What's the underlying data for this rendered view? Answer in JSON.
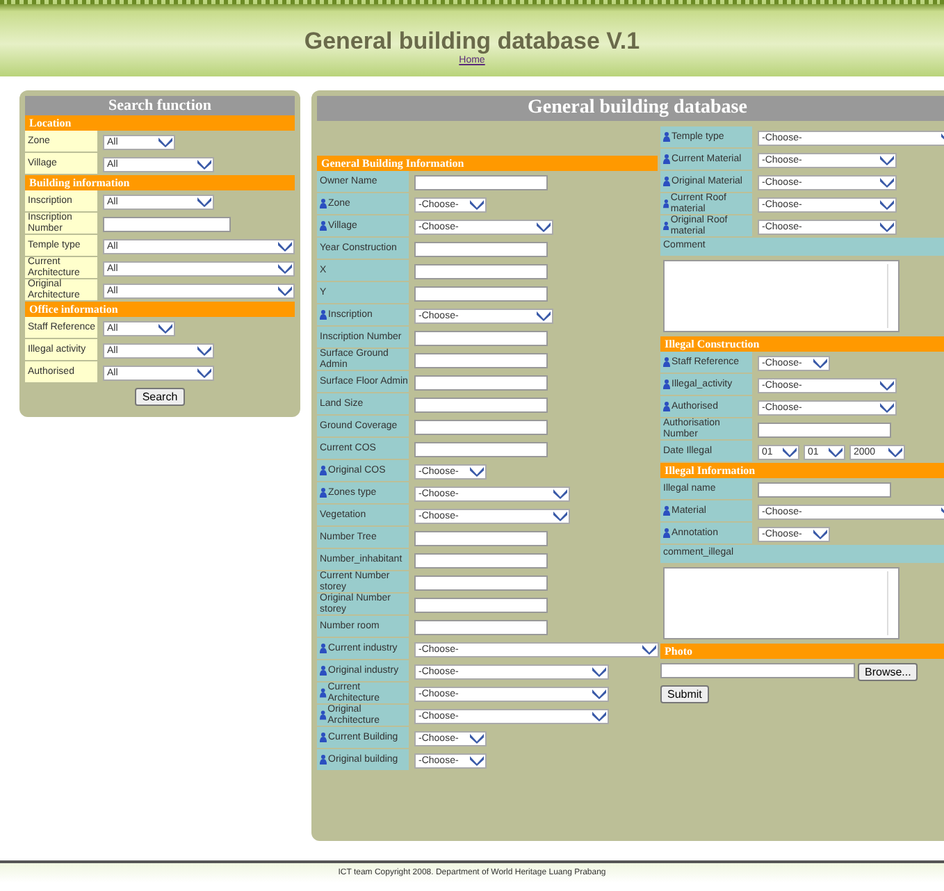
{
  "header": {
    "title": "General building database V.1",
    "link": "Home"
  },
  "search_panel": {
    "title": "Search function",
    "button": "Search",
    "sections": [
      {
        "title": "Location",
        "rows": [
          {
            "label": "Zone",
            "kind": "short-select",
            "value": "All"
          },
          {
            "label": "Village",
            "kind": "select",
            "value": "All"
          }
        ]
      },
      {
        "title": "Building information",
        "rows": [
          {
            "label": "Inscription",
            "kind": "select",
            "value": "All"
          },
          {
            "label": "Inscription Number",
            "kind": "input"
          },
          {
            "label": "Temple type",
            "kind": "wide-select",
            "value": "All"
          },
          {
            "label": "Current Architecture",
            "kind": "wide-select",
            "value": "All"
          },
          {
            "label": "Original Architecture",
            "kind": "wide-select",
            "value": "All"
          }
        ]
      },
      {
        "title": "Office information",
        "rows": [
          {
            "label": "Staff Reference",
            "kind": "short-select",
            "value": "All"
          },
          {
            "label": "Illegal activity",
            "kind": "select",
            "value": "All"
          },
          {
            "label": "Authorised",
            "kind": "select",
            "value": "All"
          }
        ]
      }
    ]
  },
  "main_panel": {
    "title": "General building database",
    "left_sections": [
      {
        "title": "General Building Information",
        "rows": [
          {
            "label": "Owner Name",
            "kind": "input",
            "marked": false
          },
          {
            "label": "Zone",
            "kind": "short-select",
            "value": "-Choose-",
            "marked": true
          },
          {
            "label": "Village",
            "kind": "select",
            "value": "-Choose-",
            "marked": true
          },
          {
            "label": "Year Construction",
            "kind": "input",
            "marked": false
          },
          {
            "label": "X",
            "kind": "input",
            "marked": false
          },
          {
            "label": "Y",
            "kind": "input",
            "marked": false
          },
          {
            "label": "Inscription",
            "kind": "select",
            "value": "-Choose-",
            "marked": true
          },
          {
            "label": "Inscription Number",
            "kind": "input",
            "marked": false
          },
          {
            "label": "Surface Ground Admin",
            "kind": "input",
            "marked": false
          },
          {
            "label": "Surface Floor Admin",
            "kind": "input",
            "marked": false
          },
          {
            "label": "Land Size",
            "kind": "input",
            "marked": false
          },
          {
            "label": "Ground Coverage",
            "kind": "input",
            "marked": false
          },
          {
            "label": "Current COS",
            "kind": "input",
            "marked": false
          },
          {
            "label": "Original COS",
            "kind": "short-select",
            "value": "-Choose-",
            "marked": true
          },
          {
            "label": "Zones type",
            "kind": "medium-select",
            "value": "-Choose-",
            "marked": true
          },
          {
            "label": "Vegetation",
            "kind": "medium-select",
            "value": "-Choose-",
            "marked": false
          },
          {
            "label": "Number Tree",
            "kind": "input",
            "marked": false
          },
          {
            "label": "Number_inhabitant",
            "kind": "input",
            "marked": false
          },
          {
            "label": "Current Number storey",
            "kind": "input",
            "marked": false
          },
          {
            "label": "Original Number storey",
            "kind": "input",
            "marked": false
          },
          {
            "label": "Number room",
            "kind": "input",
            "marked": false
          },
          {
            "label": "Current industry",
            "kind": "wide-select",
            "value": "-Choose-",
            "marked": true
          },
          {
            "label": "Original industry",
            "kind": "large-select",
            "value": "-Choose-",
            "marked": true
          },
          {
            "label": "Current Architecture",
            "kind": "large-select",
            "value": "-Choose-",
            "marked": true
          },
          {
            "label": "Original Architecture",
            "kind": "large-select",
            "value": "-Choose-",
            "marked": true
          },
          {
            "label": "Current Building",
            "kind": "short-select",
            "value": "-Choose-",
            "marked": true
          },
          {
            "label": "Original building",
            "kind": "short-select",
            "value": "-Choose-",
            "marked": true
          }
        ]
      }
    ],
    "right_sections": [
      {
        "rows": [
          {
            "label": "Temple type",
            "kind": "wide-select",
            "value": "-Choose-",
            "marked": true
          },
          {
            "label": "Current Material",
            "kind": "select",
            "value": "-Choose-",
            "marked": true
          },
          {
            "label": "Original Material",
            "kind": "select",
            "value": "-Choose-",
            "marked": true
          },
          {
            "label": "Current Roof material",
            "kind": "select",
            "value": "-Choose-",
            "marked": true
          },
          {
            "label": "Original Roof material",
            "kind": "select",
            "value": "-Choose-",
            "marked": true
          },
          {
            "label": "Comment",
            "kind": "textarea"
          }
        ]
      },
      {
        "title": "Illegal Construction",
        "rows": [
          {
            "label": "Staff Reference",
            "kind": "short-select",
            "value": "-Choose-",
            "marked": true
          },
          {
            "label": "Illegal_activity",
            "kind": "select",
            "value": "-Choose-",
            "marked": true
          },
          {
            "label": "Authorised",
            "kind": "select",
            "value": "-Choose-",
            "marked": true
          },
          {
            "label": "Authorisation Number",
            "kind": "input",
            "marked": false
          },
          {
            "label": "Date Illegal",
            "kind": "date",
            "values": [
              "01",
              "01",
              "2000"
            ],
            "marked": false
          }
        ]
      },
      {
        "title": "Illegal Information",
        "rows": [
          {
            "label": "Illegal name",
            "kind": "input",
            "marked": false
          },
          {
            "label": "Material",
            "kind": "wide-select",
            "value": "-Choose-",
            "marked": true
          },
          {
            "label": "Annotation",
            "kind": "short-select",
            "value": "-Choose-",
            "marked": true
          },
          {
            "label": "comment_illegal",
            "kind": "textarea"
          }
        ]
      },
      {
        "title": "Photo",
        "rows": [
          {
            "kind": "file",
            "button": "Browse..."
          }
        ]
      }
    ],
    "submit": "Submit"
  },
  "footer": "ICT team Copyright 2008. Department of World Heritage Luang Prabang"
}
